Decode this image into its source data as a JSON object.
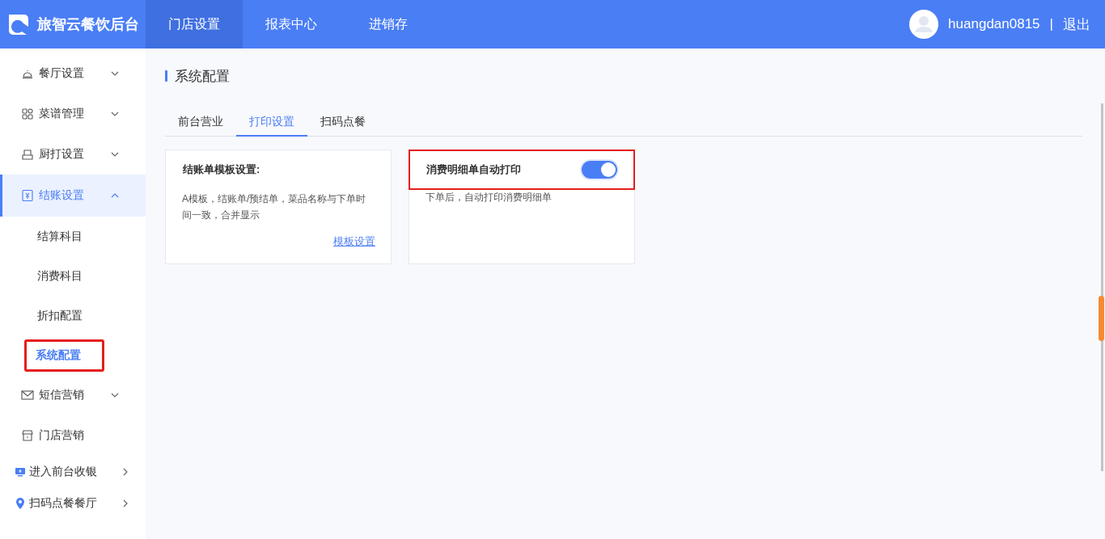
{
  "header": {
    "brand": "旅智云餐饮后台",
    "nav": [
      {
        "label": "门店设置",
        "selected": true
      },
      {
        "label": "报表中心",
        "selected": false
      },
      {
        "label": "进销存",
        "selected": false
      }
    ],
    "user": {
      "name": "huangdan0815",
      "separator": "|",
      "logout": "退出"
    }
  },
  "sidebar": {
    "items": [
      {
        "kind": "group",
        "label": "餐厅设置",
        "expanded": false,
        "selected": false
      },
      {
        "kind": "group",
        "label": "菜谱管理",
        "expanded": false,
        "selected": false
      },
      {
        "kind": "group",
        "label": "厨打设置",
        "expanded": false,
        "selected": false
      },
      {
        "kind": "group",
        "label": "结账设置",
        "expanded": true,
        "selected": true,
        "children": [
          {
            "label": "结算科目",
            "selected": false,
            "highlighted": false
          },
          {
            "label": "消费科目",
            "selected": false,
            "highlighted": false
          },
          {
            "label": "折扣配置",
            "selected": false,
            "highlighted": false
          },
          {
            "label": "系统配置",
            "selected": true,
            "highlighted": true
          }
        ]
      },
      {
        "kind": "group",
        "label": "短信营销",
        "expanded": false,
        "selected": false
      },
      {
        "kind": "entry",
        "label": "门店营销",
        "selected": false
      },
      {
        "kind": "link",
        "label": "进入前台收银",
        "selected": false
      },
      {
        "kind": "link",
        "label": "扫码点餐餐厅",
        "selected": false
      }
    ]
  },
  "page": {
    "title": "系统配置",
    "tabs": [
      {
        "label": "前台营业",
        "selected": false
      },
      {
        "label": "打印设置",
        "selected": true
      },
      {
        "label": "扫码点餐",
        "selected": false
      }
    ],
    "cards": [
      {
        "kind": "template",
        "title": "结账单模板设置:",
        "description": "A模板，结账单/预结单，菜品名称与下单时间一致，合并显示",
        "link": "模板设置",
        "highlighted": false
      },
      {
        "kind": "toggle",
        "title": "消费明细单自动打印",
        "on": true,
        "description": "下单后，自动打印消费明细单",
        "highlighted": true
      }
    ]
  }
}
